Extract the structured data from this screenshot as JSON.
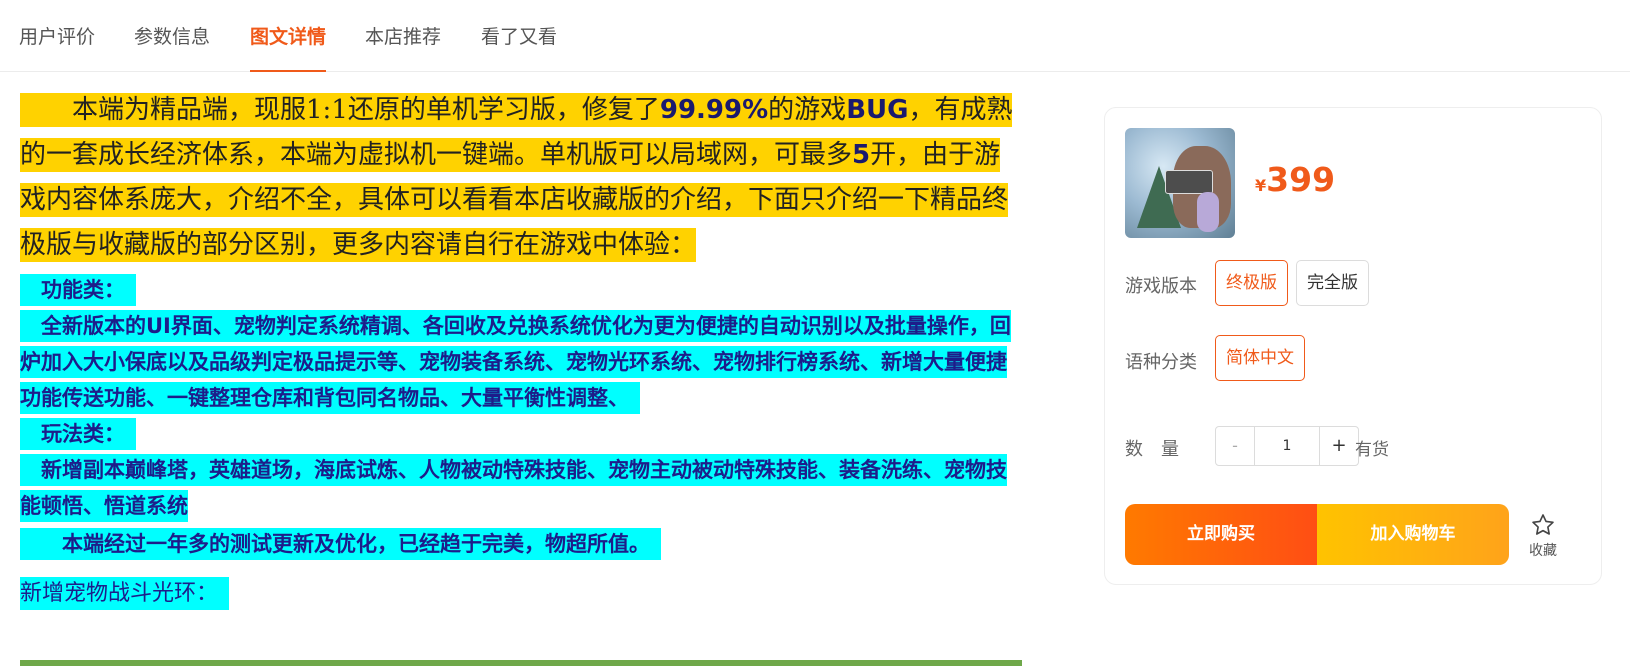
{
  "tabs": [
    {
      "label": "用户评价",
      "active": false
    },
    {
      "label": "参数信息",
      "active": false
    },
    {
      "label": "图文详情",
      "active": true
    },
    {
      "label": "本店推荐",
      "active": false
    },
    {
      "label": "看了又看",
      "active": false
    }
  ],
  "description": {
    "intro": [
      {
        "text": "本端为精品端，现服1:1还原的单机学习版，修复了",
        "bold": false
      },
      {
        "text": "99.99%",
        "bold": true
      },
      {
        "text": "的游戏",
        "bold": false
      },
      {
        "text": "BUG",
        "bold": true
      },
      {
        "text": "，有成熟的一套成长经济体系，本端为虚拟机一键端。单机版可以局域网，可最多",
        "bold": false
      },
      {
        "text": "5",
        "bold": true
      },
      {
        "text": "开，由于游戏内容体系庞大，介绍不全，具体可以看看本店收藏版的介绍，下面只介绍一下精品终极版与收藏版的部分区别，更多内容请自行在游戏中体验：",
        "bold": false
      }
    ],
    "feature_heading": "功能类：",
    "feature_text": "全新版本的UI界面、宠物判定系统精调、各回收及兑换系统优化为更为便捷的自动识别以及批量操作，回炉加入大小保底以及品级判定极品提示等、宠物装备系统、宠物光环系统、宠物排行榜系统、新增大量便捷功能传送功能、一键整理仓库和背包同名物品、大量平衡性调整、",
    "gameplay_heading": "玩法类：",
    "gameplay_text": "新增副本巅峰塔，英雄道场，海底试炼、人物被动特殊技能、宠物主动被动特殊技能、装备洗练、宠物技能顿悟、悟道系统",
    "summary": "本端经过一年多的测试更新及优化，已经趋于完美，物超所值。",
    "pet_aura_heading": "新增宠物战斗光环："
  },
  "product": {
    "price_symbol": "¥",
    "price": "399",
    "version_label": "游戏版本",
    "versions": [
      {
        "label": "终极版",
        "selected": true
      },
      {
        "label": "完全版",
        "selected": false
      }
    ],
    "language_label": "语种分类",
    "languages": [
      {
        "label": "简体中文",
        "selected": true
      }
    ],
    "quantity_label": "数　量",
    "minus": "-",
    "plus": "+",
    "quantity": "1",
    "stock_status": "有货",
    "buy_now": "立即购买",
    "add_to_cart": "加入购物车",
    "favorite": "收藏"
  },
  "colors": {
    "accent": "#f05a1a",
    "highlight_yellow": "#ffd200",
    "highlight_cyan": "#00ffff"
  },
  "icons": {
    "favorite": "star-outline-icon"
  }
}
